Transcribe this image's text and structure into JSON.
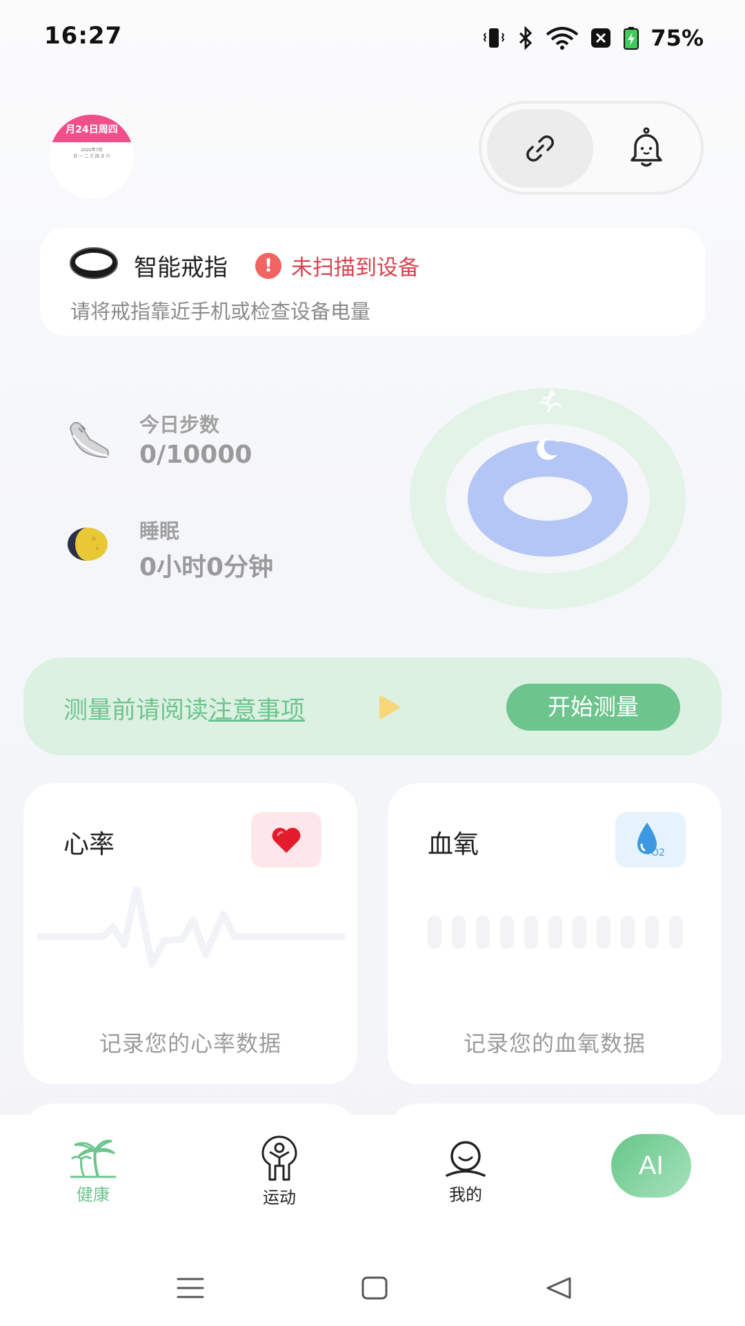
{
  "status_bar": {
    "time": "16:27",
    "battery": "75%"
  },
  "header": {
    "avatar_date": "月24日周四",
    "avatar_month": "2025年7月",
    "avatar_weekdays": "日 一 二 三 四 五 六"
  },
  "device": {
    "name": "智能戒指",
    "status": "未扫描到设备",
    "hint": "请将戒指靠近手机或检查设备电量",
    "warn_symbol": "!"
  },
  "steps": {
    "label": "今日步数",
    "value": "0/10000"
  },
  "sleep": {
    "label": "睡眠",
    "value": "0小时0分钟"
  },
  "measure": {
    "prefix": "测量前请阅读",
    "link": "注意事项",
    "button": "开始测量"
  },
  "heart_rate": {
    "title": "心率",
    "desc": "记录您的心率数据"
  },
  "blood_oxygen": {
    "title": "血氧",
    "desc": "记录您的血氧数据",
    "badge_text": "O2"
  },
  "nav": {
    "health": "健康",
    "sport": "运动",
    "mine": "我的",
    "ai": "AI"
  },
  "colors": {
    "accent_green": "#6dc48d",
    "warning_red": "#d8434f",
    "ring_outer": "#e3f3e8",
    "ring_inner": "#b3c6f5"
  },
  "icons": {
    "link": "link-icon",
    "bell": "bell-icon",
    "shoe": "shoe-icon",
    "moon": "moon-icon",
    "heart": "heart-icon",
    "drop": "oxygen-drop-icon",
    "palm": "palm-tree-icon",
    "person": "person-icon",
    "face": "face-icon"
  }
}
